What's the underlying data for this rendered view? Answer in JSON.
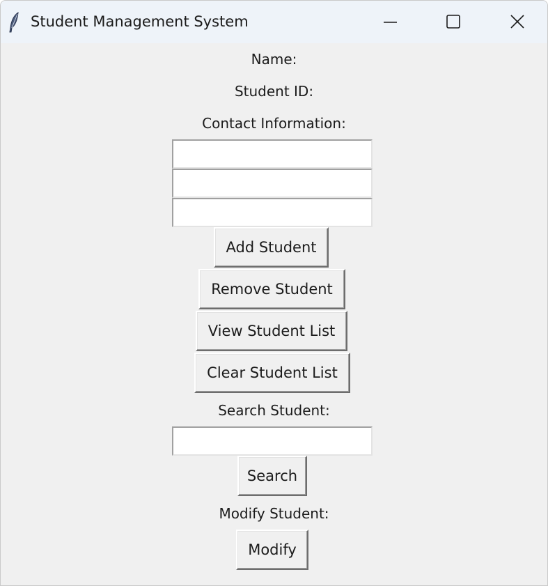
{
  "window": {
    "title": "Student Management System",
    "icon": "feather-icon",
    "controls": {
      "minimize": "minimize-icon",
      "maximize": "maximize-icon",
      "close": "close-icon"
    }
  },
  "form": {
    "name_label": "Name:",
    "student_id_label": "Student ID:",
    "contact_label": "Contact Information:",
    "name_value": "",
    "student_id_value": "",
    "contact_value": ""
  },
  "buttons": {
    "add": "Add Student",
    "remove": "Remove Student",
    "view": "View Student List",
    "clear": "Clear Student List",
    "search": "Search",
    "modify": "Modify"
  },
  "search": {
    "label": "Search Student:",
    "value": ""
  },
  "modify": {
    "label": "Modify Student:"
  },
  "colors": {
    "titlebar": "#eef3f9",
    "window_bg": "#f0f0f0",
    "entry_bg": "#ffffff"
  }
}
